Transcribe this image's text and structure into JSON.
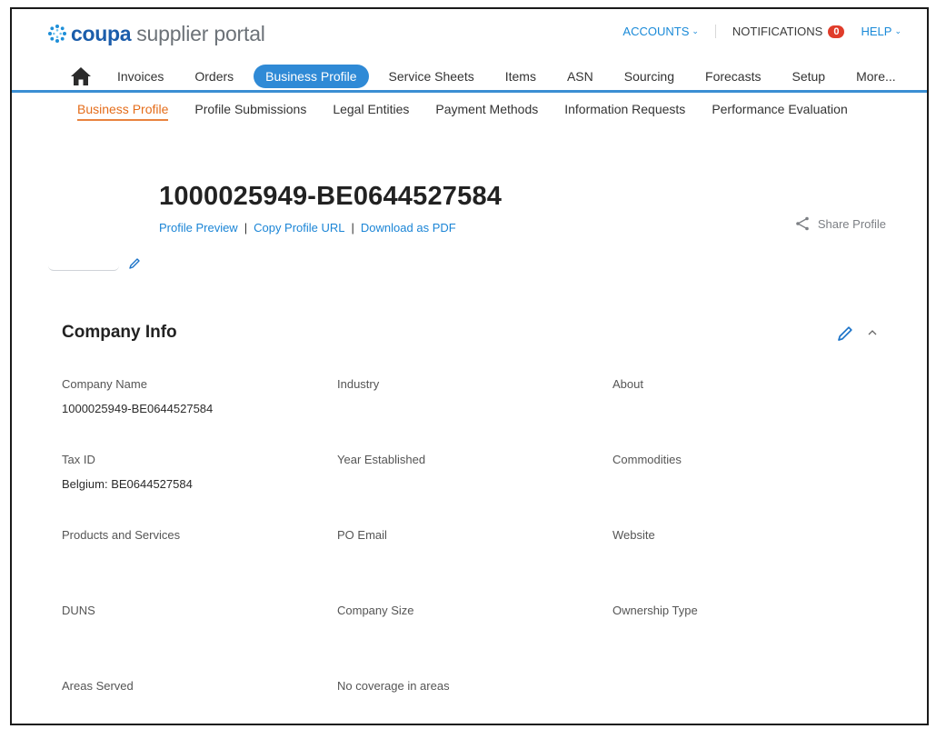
{
  "header": {
    "brand": "coupa",
    "brand_rest": "supplier portal",
    "accounts_label": "ACCOUNTS",
    "notifications_label": "NOTIFICATIONS",
    "notifications_count": "0",
    "help_label": "HELP"
  },
  "nav": {
    "items": [
      "Invoices",
      "Orders",
      "Business Profile",
      "Service Sheets",
      "Items",
      "ASN",
      "Sourcing",
      "Forecasts",
      "Setup",
      "More..."
    ],
    "active_index": 2
  },
  "subnav": {
    "items": [
      "Business Profile",
      "Profile Submissions",
      "Legal Entities",
      "Payment Methods",
      "Information Requests",
      "Performance Evaluation"
    ],
    "active_index": 0
  },
  "profile": {
    "title": "1000025949-BE0644527584",
    "link_preview": "Profile Preview",
    "link_copy_url": "Copy Profile URL",
    "link_download_pdf": "Download as PDF",
    "share_label": "Share Profile"
  },
  "company_info": {
    "title": "Company Info",
    "fields": [
      {
        "label": "Company Name",
        "value": "1000025949-BE0644527584"
      },
      {
        "label": "Industry",
        "value": ""
      },
      {
        "label": "About",
        "value": ""
      },
      {
        "label": "Tax ID",
        "value": "Belgium: BE0644527584"
      },
      {
        "label": "Year Established",
        "value": ""
      },
      {
        "label": "Commodities",
        "value": ""
      },
      {
        "label": "Products and Services",
        "value": ""
      },
      {
        "label": "PO Email",
        "value": ""
      },
      {
        "label": "Website",
        "value": ""
      },
      {
        "label": "DUNS",
        "value": ""
      },
      {
        "label": "Company Size",
        "value": ""
      },
      {
        "label": "Ownership Type",
        "value": ""
      },
      {
        "label": "Areas Served",
        "value": ""
      },
      {
        "label": "No coverage in areas",
        "value": ""
      }
    ]
  },
  "colors": {
    "brand_blue": "#1b5dab",
    "nav_active": "#2f8ad6",
    "subnav_active": "#e46d1b",
    "link_blue": "#1b85d6",
    "badge_red": "#e03c2a"
  },
  "icons": {
    "logo": "coupa-burst-icon",
    "home": "home-icon",
    "share": "share-icon",
    "edit": "pencil-icon",
    "collapse": "chevron-up-icon"
  }
}
